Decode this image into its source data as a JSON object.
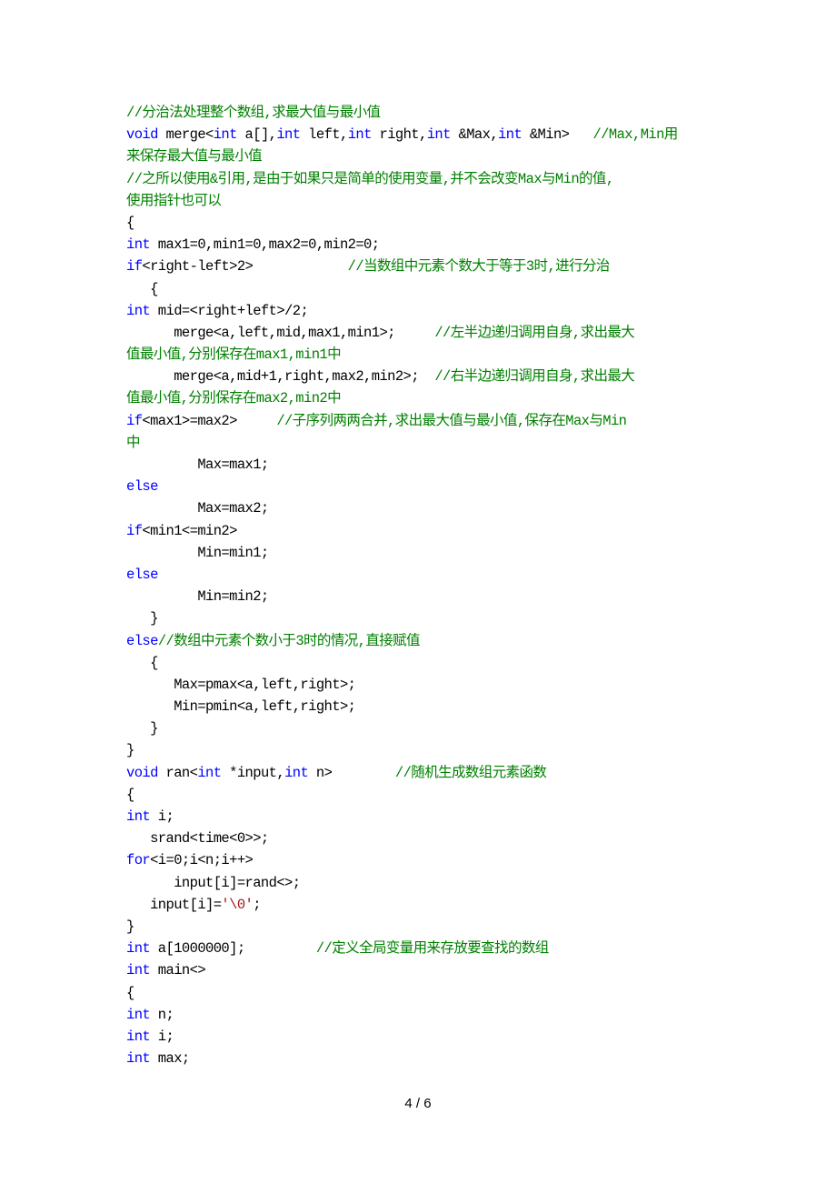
{
  "document": {
    "colors": {
      "keyword": "#0000ff",
      "comment": "#008000",
      "string": "#a31515",
      "text": "#000000"
    },
    "lines": [
      [
        {
          "t": "cm",
          "v": "//分治法处理整个数组,求最大值与最小值"
        }
      ],
      [
        {
          "t": "kw",
          "v": "void"
        },
        {
          "t": "tx",
          "v": " merge<"
        },
        {
          "t": "kw",
          "v": "int"
        },
        {
          "t": "tx",
          "v": " a[],"
        },
        {
          "t": "kw",
          "v": "int"
        },
        {
          "t": "tx",
          "v": " left,"
        },
        {
          "t": "kw",
          "v": "int"
        },
        {
          "t": "tx",
          "v": " right,"
        },
        {
          "t": "kw",
          "v": "int"
        },
        {
          "t": "tx",
          "v": " &Max,"
        },
        {
          "t": "kw",
          "v": "int"
        },
        {
          "t": "tx",
          "v": " &Min>   "
        },
        {
          "t": "cm",
          "v": "//Max,Min用"
        }
      ],
      [
        {
          "t": "cm",
          "v": "来保存最大值与最小值"
        }
      ],
      [
        {
          "t": "cm",
          "v": "//之所以使用&引用,是由于如果只是简单的使用变量,并不会改变Max与Min的值,"
        }
      ],
      [
        {
          "t": "cm",
          "v": "使用指针也可以"
        }
      ],
      [
        {
          "t": "tx",
          "v": "{"
        }
      ],
      [
        {
          "t": "kw",
          "v": "int"
        },
        {
          "t": "tx",
          "v": " max1=0,min1=0,max2=0,min2=0;"
        }
      ],
      [
        {
          "t": "kw",
          "v": "if"
        },
        {
          "t": "tx",
          "v": "<right-left>2>            "
        },
        {
          "t": "cm",
          "v": "//当数组中元素个数大于等于3时,进行分治"
        }
      ],
      [
        {
          "t": "tx",
          "v": "   {"
        }
      ],
      [
        {
          "t": "kw",
          "v": "int"
        },
        {
          "t": "tx",
          "v": " mid=<right+left>/2;"
        }
      ],
      [
        {
          "t": "tx",
          "v": "      merge<a,left,mid,max1,min1>;     "
        },
        {
          "t": "cm",
          "v": "//左半边递归调用自身,求出最大"
        }
      ],
      [
        {
          "t": "cm",
          "v": "值最小值,分别保存在max1,min1中"
        }
      ],
      [
        {
          "t": "tx",
          "v": "      merge<a,mid+1,right,max2,min2>;  "
        },
        {
          "t": "cm",
          "v": "//右半边递归调用自身,求出最大"
        }
      ],
      [
        {
          "t": "cm",
          "v": "值最小值,分别保存在max2,min2中"
        }
      ],
      [
        {
          "t": "kw",
          "v": "if"
        },
        {
          "t": "tx",
          "v": "<max1>=max2>     "
        },
        {
          "t": "cm",
          "v": "//子序列两两合并,求出最大值与最小值,保存在Max与Min"
        }
      ],
      [
        {
          "t": "cm",
          "v": "中"
        }
      ],
      [
        {
          "t": "tx",
          "v": "         Max=max1;"
        }
      ],
      [
        {
          "t": "kw",
          "v": "else"
        }
      ],
      [
        {
          "t": "tx",
          "v": "         Max=max2;"
        }
      ],
      [
        {
          "t": "kw",
          "v": "if"
        },
        {
          "t": "tx",
          "v": "<min1<=min2>"
        }
      ],
      [
        {
          "t": "tx",
          "v": "         Min=min1;"
        }
      ],
      [
        {
          "t": "kw",
          "v": "else"
        }
      ],
      [
        {
          "t": "tx",
          "v": "         Min=min2;"
        }
      ],
      [
        {
          "t": "tx",
          "v": "   }"
        }
      ],
      [
        {
          "t": "kw",
          "v": "else"
        },
        {
          "t": "cm",
          "v": "//数组中元素个数小于3时的情况,直接赋值"
        }
      ],
      [
        {
          "t": "tx",
          "v": "   {"
        }
      ],
      [
        {
          "t": "tx",
          "v": "      Max=pmax<a,left,right>;"
        }
      ],
      [
        {
          "t": "tx",
          "v": "      Min=pmin<a,left,right>;"
        }
      ],
      [
        {
          "t": "tx",
          "v": "   }"
        }
      ],
      [
        {
          "t": "tx",
          "v": "}"
        }
      ],
      [
        {
          "t": "kw",
          "v": "void"
        },
        {
          "t": "tx",
          "v": " ran<"
        },
        {
          "t": "kw",
          "v": "int"
        },
        {
          "t": "tx",
          "v": " *input,"
        },
        {
          "t": "kw",
          "v": "int"
        },
        {
          "t": "tx",
          "v": " n>        "
        },
        {
          "t": "cm",
          "v": "//随机生成数组元素函数"
        }
      ],
      [
        {
          "t": "tx",
          "v": "{"
        }
      ],
      [
        {
          "t": "kw",
          "v": "int"
        },
        {
          "t": "tx",
          "v": " i;"
        }
      ],
      [
        {
          "t": "tx",
          "v": "   srand<time<0>>;"
        }
      ],
      [
        {
          "t": "kw",
          "v": "for"
        },
        {
          "t": "tx",
          "v": "<i=0;i<n;i++>"
        }
      ],
      [
        {
          "t": "tx",
          "v": "      input[i]=rand<>;"
        }
      ],
      [
        {
          "t": "tx",
          "v": "   input[i]="
        },
        {
          "t": "st",
          "v": "'\\0'"
        },
        {
          "t": "tx",
          "v": ";"
        }
      ],
      [
        {
          "t": "tx",
          "v": "}"
        }
      ],
      [
        {
          "t": "kw",
          "v": "int"
        },
        {
          "t": "tx",
          "v": " a[1000000];         "
        },
        {
          "t": "cm",
          "v": "//定义全局变量用来存放要查找的数组"
        }
      ],
      [
        {
          "t": "kw",
          "v": "int"
        },
        {
          "t": "tx",
          "v": " main<>"
        }
      ],
      [
        {
          "t": "tx",
          "v": "{"
        }
      ],
      [
        {
          "t": "kw",
          "v": "int"
        },
        {
          "t": "tx",
          "v": " n;"
        }
      ],
      [
        {
          "t": "kw",
          "v": "int"
        },
        {
          "t": "tx",
          "v": " i;"
        }
      ],
      [
        {
          "t": "kw",
          "v": "int"
        },
        {
          "t": "tx",
          "v": " max;"
        }
      ]
    ],
    "page_number": "4 / 6"
  }
}
